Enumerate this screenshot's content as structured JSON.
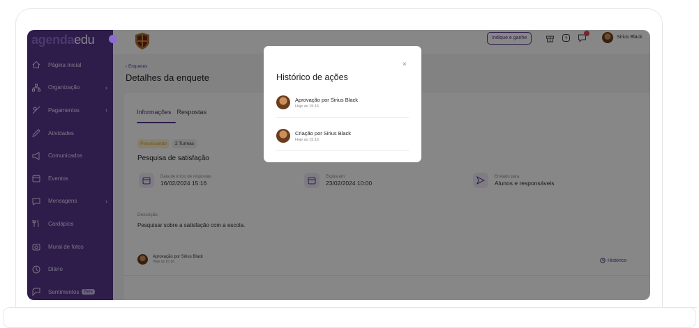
{
  "app": {
    "logo_bold": "agenda",
    "logo_light": "edu",
    "user_name": "Sirius Black",
    "referral_label": "Indique e ganhe"
  },
  "sidebar": {
    "items": [
      {
        "label": "Página Inicial",
        "icon": "home-icon",
        "chevron": ""
      },
      {
        "label": "Organização",
        "icon": "org-chart-icon",
        "chevron": "›"
      },
      {
        "label": "Pagamentos",
        "icon": "payments-icon",
        "chevron": "›"
      },
      {
        "label": "Atividades",
        "icon": "pencil-icon",
        "chevron": ""
      },
      {
        "label": "Comunicados",
        "icon": "megaphone-icon",
        "chevron": ""
      },
      {
        "label": "Eventos",
        "icon": "calendar-icon",
        "chevron": ""
      },
      {
        "label": "Mensagens",
        "icon": "chat-icon",
        "chevron": "›"
      },
      {
        "label": "Cardápios",
        "icon": "cutlery-icon",
        "chevron": ""
      },
      {
        "label": "Mural de fotos",
        "icon": "camera-icon",
        "chevron": ""
      },
      {
        "label": "Diário",
        "icon": "diary-icon",
        "chevron": ""
      },
      {
        "label": "Sentimentos",
        "icon": "feelings-icon",
        "chevron": "",
        "badge": "Beta"
      }
    ]
  },
  "page": {
    "breadcrumb": "‹ Enquetes",
    "title": "Detalhes da enquete",
    "tabs": [
      {
        "label": "Informações",
        "active": true
      },
      {
        "label": "Respostas",
        "active": false
      }
    ],
    "status_chip": "Processando",
    "turmas_chip": "2 Turmas",
    "survey_title": "Pesquisa de satisfação",
    "info": [
      {
        "label": "Data de início de respostas",
        "value": "16/02/2024 15:16",
        "icon": "calendar-icon"
      },
      {
        "label": "Expira em",
        "value": "23/02/2024 10:00",
        "icon": "calendar-icon"
      },
      {
        "label": "Enviado para",
        "value": "Alunos e responsáveis",
        "icon": "send-icon"
      }
    ],
    "description_label": "Descrição",
    "description": "Pesquisar sobre a satisfação com a escola.",
    "approval": {
      "title": "Aprovação por Sirius Black",
      "time": "Hoje às 15:16"
    },
    "history_link": "Histórico"
  },
  "modal": {
    "title": "Histórico de ações",
    "close": "×",
    "items": [
      {
        "title": "Aprovação por Sirius Black",
        "time": "Hoje às 15:16"
      },
      {
        "title": "Criação por Sirius Black",
        "time": "Hoje às 15:16"
      }
    ]
  },
  "colors": {
    "brand": "#58358e",
    "brand_light": "#8b6fd0",
    "status_warning": "#d59a1c"
  }
}
